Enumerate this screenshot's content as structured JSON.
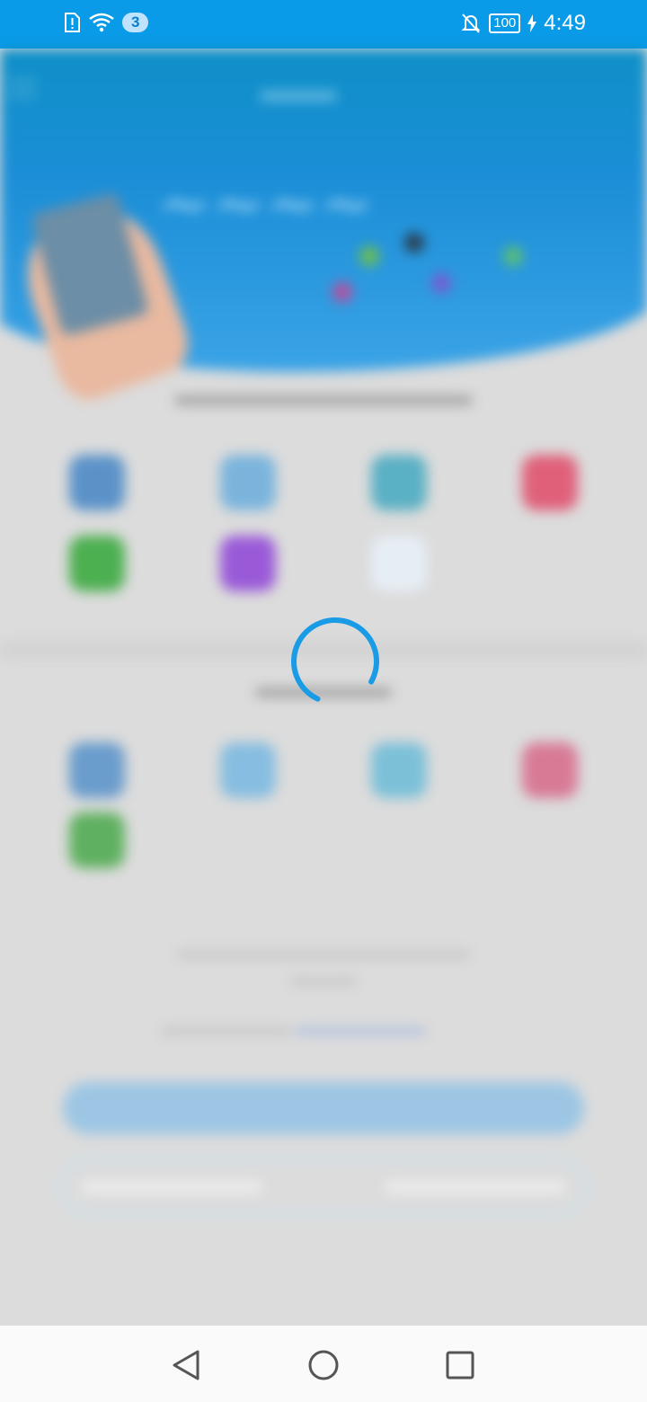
{
  "status_bar": {
    "notification_count": "3",
    "battery": "100",
    "time": "4:49",
    "icons": [
      "sim-alert-icon",
      "wifi-icon",
      "bell-off-icon",
      "battery-icon",
      "charging-icon"
    ]
  },
  "loading": {
    "spinner_color": "#1a9be6"
  },
  "navigation": {
    "icons": [
      "back-icon",
      "home-icon",
      "recent-apps-icon"
    ]
  },
  "colors": {
    "status_bar": "#0a9be8",
    "scrim": "#dcdcdc",
    "nav_bar": "#fafafa"
  }
}
